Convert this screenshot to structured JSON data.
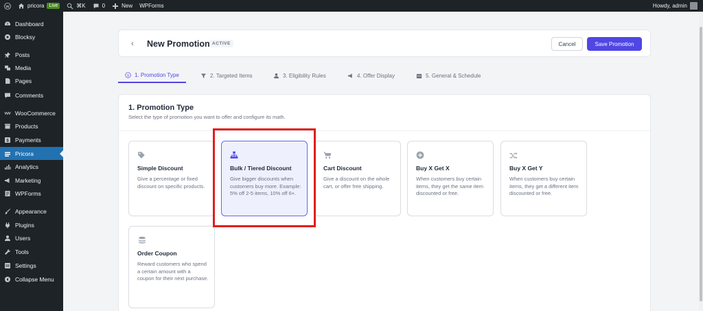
{
  "adminbar": {
    "site_name": "pricora",
    "live_badge": "Live",
    "shortcut": "⌘K",
    "comments_count": "0",
    "new_label": "New",
    "wpforms_label": "WPForms",
    "greeting": "Howdy, admin"
  },
  "sidebar": {
    "items": [
      {
        "label": "Dashboard",
        "icon": "dashboard-icon"
      },
      {
        "label": "Blocksy",
        "icon": "blocksy-icon"
      },
      {
        "label": "Posts",
        "icon": "pin-icon"
      },
      {
        "label": "Media",
        "icon": "media-icon"
      },
      {
        "label": "Pages",
        "icon": "page-icon"
      },
      {
        "label": "Comments",
        "icon": "comment-icon"
      },
      {
        "label": "WooCommerce",
        "icon": "woo-icon"
      },
      {
        "label": "Products",
        "icon": "archive-icon"
      },
      {
        "label": "Payments",
        "icon": "dollar-icon"
      },
      {
        "label": "Pricora",
        "icon": "pricora-icon"
      },
      {
        "label": "Analytics",
        "icon": "bar-chart-icon"
      },
      {
        "label": "Marketing",
        "icon": "megaphone-icon"
      },
      {
        "label": "WPForms",
        "icon": "form-icon"
      },
      {
        "label": "Appearance",
        "icon": "brush-icon"
      },
      {
        "label": "Plugins",
        "icon": "plug-icon"
      },
      {
        "label": "Users",
        "icon": "user-icon"
      },
      {
        "label": "Tools",
        "icon": "wrench-icon"
      },
      {
        "label": "Settings",
        "icon": "settings-icon"
      },
      {
        "label": "Collapse Menu",
        "icon": "collapse-icon"
      }
    ],
    "active": "Pricora"
  },
  "header": {
    "back": "‹",
    "title": "New Promotion",
    "status": "ACTIVE",
    "cancel_label": "Cancel",
    "save_label": "Save Promotion"
  },
  "tabs": [
    {
      "label": "1. Promotion Type",
      "icon": "dollar-circle-icon",
      "active": true
    },
    {
      "label": "2. Targeted Items",
      "icon": "filter-icon",
      "active": false
    },
    {
      "label": "3. Eligibility Rules",
      "icon": "user-icon",
      "active": false
    },
    {
      "label": "4. Offer Display",
      "icon": "megaphone-icon",
      "active": false
    },
    {
      "label": "5. General & Schedule",
      "icon": "calendar-icon",
      "active": false
    }
  ],
  "section": {
    "title": "1. Promotion Type",
    "subtitle": "Select the type of promotion you want to offer and configure its math."
  },
  "promotion_types": [
    {
      "title": "Simple Discount",
      "desc": "Give a percentage or fixed discount on specific products.",
      "icon": "tag-icon",
      "selected": false
    },
    {
      "title": "Bulk / Tiered Discount",
      "desc": "Give bigger discounts when customers buy more. Example: 5% off 2-5 items, 10% off 6+.",
      "icon": "hierarchy-icon",
      "selected": true
    },
    {
      "title": "Cart Discount",
      "desc": "Give a discount on the whole cart, or offer free shipping.",
      "icon": "cart-icon",
      "selected": false
    },
    {
      "title": "Buy X Get X",
      "desc": "When customers buy certain items, they get the same item discounted or free.",
      "icon": "plus-circle-icon",
      "selected": false
    },
    {
      "title": "Buy X Get Y",
      "desc": "When customers buy certain items, they get a different item discounted or free.",
      "icon": "shuffle-icon",
      "selected": false
    },
    {
      "title": "Order Coupon",
      "desc": "Reward customers who spend a certain amount with a coupon for their next purchase.",
      "icon": "coins-icon",
      "selected": false
    }
  ],
  "colors": {
    "accent": "#4f46e5",
    "wp_blue": "#2271b1",
    "sidebar_bg": "#1d2327",
    "highlight": "#e11d1d"
  }
}
